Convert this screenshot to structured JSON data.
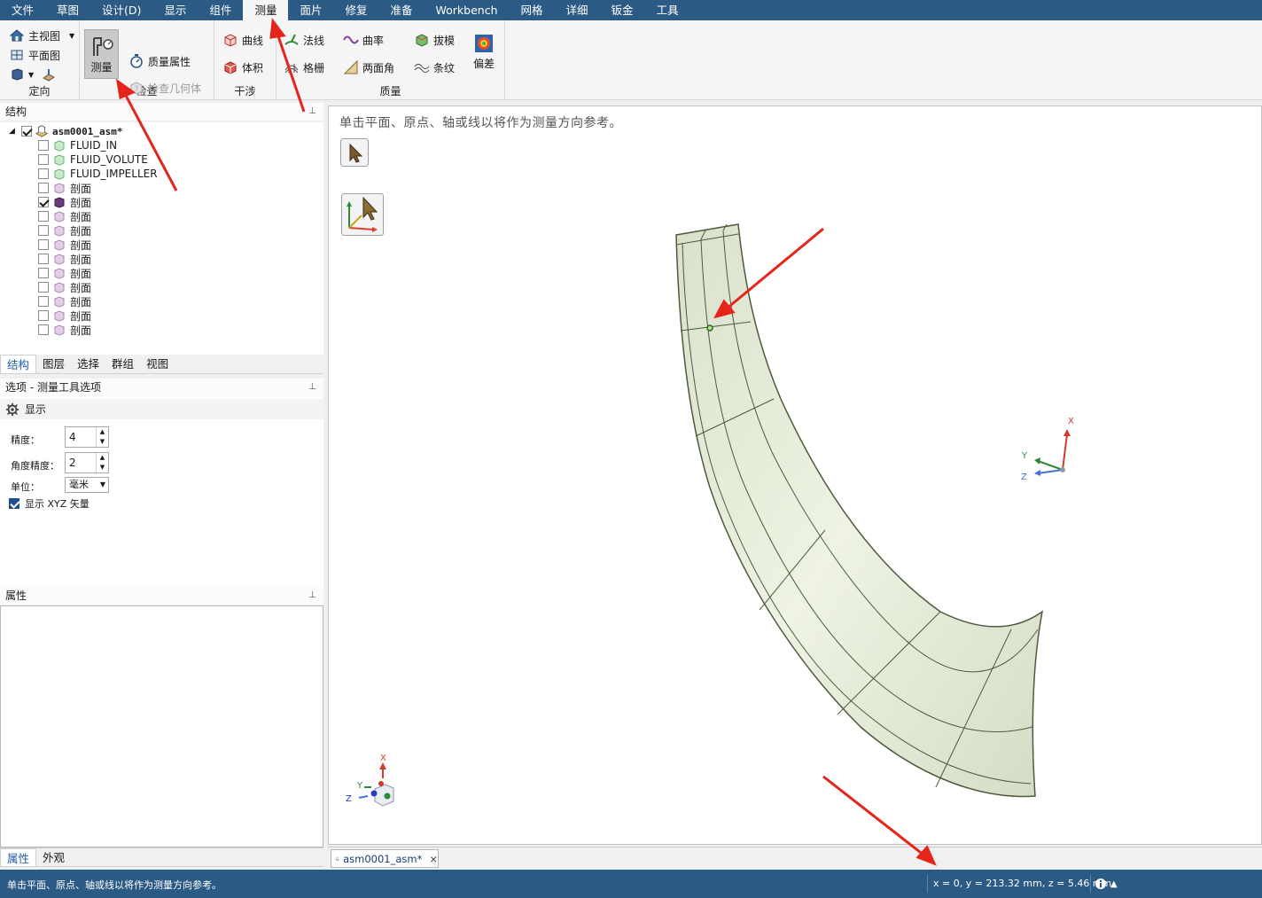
{
  "menu": [
    "文件",
    "草图",
    "设计(D)",
    "显示",
    "组件",
    "测量",
    "面片",
    "修复",
    "准备",
    "Workbench",
    "网格",
    "详细",
    "钣金",
    "工具"
  ],
  "menu_active": "测量",
  "ribbon": {
    "orient": {
      "label": "定向",
      "home": "主视图",
      "plan": "平面图"
    },
    "inspect": {
      "label": "检查",
      "measure": "测量",
      "mass_props": "质量属性",
      "check_geom": "检查几何体"
    },
    "interfere": {
      "label": "干涉",
      "curve": "曲线",
      "volume": "体积"
    },
    "quality": {
      "label": "质量",
      "normal": "法线",
      "grid": "格栅",
      "curvature": "曲率",
      "dihedral": "两面角",
      "draft": "拔模",
      "stripes": "条纹",
      "deviation": "偏差"
    }
  },
  "structure": {
    "title": "结构",
    "root": "asm0001_asm*",
    "items": [
      {
        "name": "FLUID_IN",
        "checked": false
      },
      {
        "name": "FLUID_VOLUTE",
        "checked": false
      },
      {
        "name": "FLUID_IMPELLER",
        "checked": false
      },
      {
        "name": "剖面",
        "checked": false
      },
      {
        "name": "剖面",
        "checked": true
      },
      {
        "name": "剖面",
        "checked": false
      },
      {
        "name": "剖面",
        "checked": false
      },
      {
        "name": "剖面",
        "checked": false
      },
      {
        "name": "剖面",
        "checked": false
      },
      {
        "name": "剖面",
        "checked": false
      },
      {
        "name": "剖面",
        "checked": false
      },
      {
        "name": "剖面",
        "checked": false
      },
      {
        "name": "剖面",
        "checked": false
      },
      {
        "name": "剖面",
        "checked": false
      }
    ]
  },
  "left_tabs": [
    "结构",
    "图层",
    "选择",
    "群组",
    "视图"
  ],
  "options": {
    "title": "选项 - 测量工具选项",
    "section": "显示",
    "precision_label": "精度：",
    "precision_value": "4",
    "angle_label": "角度精度：",
    "angle_value": "2",
    "unit_label": "单位：",
    "unit_value": "毫米",
    "show_xyz": "显示 XYZ 矢量"
  },
  "properties": {
    "title": "属性"
  },
  "bottom_tabs": [
    "属性",
    "外观"
  ],
  "viewport": {
    "hint": "单击平面、原点、轴或线以将作为测量方向参考。"
  },
  "axis_labels": {
    "x": "X",
    "y": "Y",
    "z": "Z"
  },
  "doc_tab": {
    "name": "asm0001_asm*",
    "close": "×"
  },
  "status": {
    "text": "单击平面、原点、轴或线以将作为测量方向参考。",
    "coords": "x = 0, y = 213.32 mm, z = 5.46 mm"
  },
  "colors": {
    "menubar": "#2b5a85",
    "surface": "#e3ead7",
    "accent_red": "#e5241b"
  }
}
